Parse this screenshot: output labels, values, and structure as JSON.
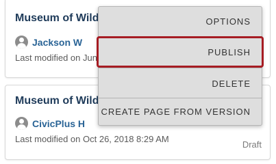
{
  "cards": [
    {
      "title": "Museum of Wildf",
      "author": "Jackson W",
      "modified": "Last modified on Jun"
    },
    {
      "title": "Museum of Wildf",
      "author": "CivicPlus H",
      "modified": "Last modified on Oct 26, 2018 8:29 AM",
      "status": "Draft"
    }
  ],
  "menu": {
    "items": [
      "OPTIONS",
      "PUBLISH",
      "DELETE",
      "CREATE PAGE FROM VERSION"
    ],
    "highlighted": "PUBLISH"
  },
  "colors": {
    "title": "#1f3b5a",
    "author_link": "#2a6496",
    "menu_background": "#dedede",
    "highlight_border": "#a61c23"
  },
  "icons": {
    "avatar": "user-avatar-icon"
  }
}
